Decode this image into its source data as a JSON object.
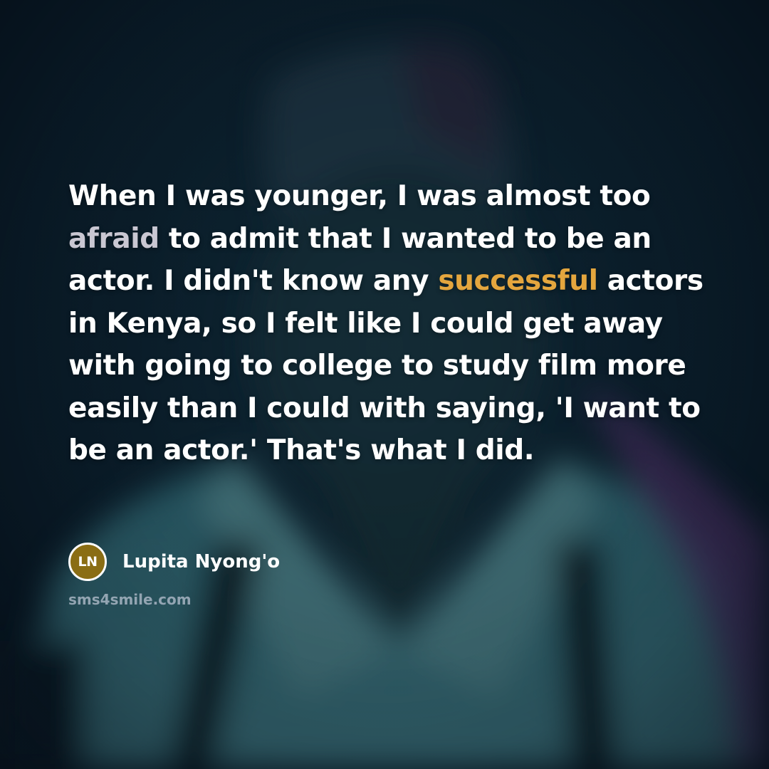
{
  "quote": {
    "segments": [
      {
        "text": "When I was younger, I was almost too ",
        "highlight": "none"
      },
      {
        "text": "afraid",
        "highlight": "gray"
      },
      {
        "text": " to admit that I wanted to be an actor. I didn't know any ",
        "highlight": "none"
      },
      {
        "text": "successful",
        "highlight": "gold"
      },
      {
        "text": " actors in Kenya, so I felt like I could get away with going to college to study film more easily than I could with saying, 'I want to be an actor.' That's what I did.",
        "highlight": "none"
      }
    ]
  },
  "author": {
    "initials": "LN",
    "name": "Lupita Nyong'o"
  },
  "site": "sms4smile.com",
  "colors": {
    "text": "#ffffff",
    "highlight_gray": "#c9c7d2",
    "highlight_gold": "#e4a63e",
    "avatar_bg": "#8a6d14",
    "site_text": "#a7b4c2"
  },
  "background": {
    "subject": "blurred photo of person in hat, teal shirt and dark suspenders",
    "icon": "portrait-photo-background"
  }
}
